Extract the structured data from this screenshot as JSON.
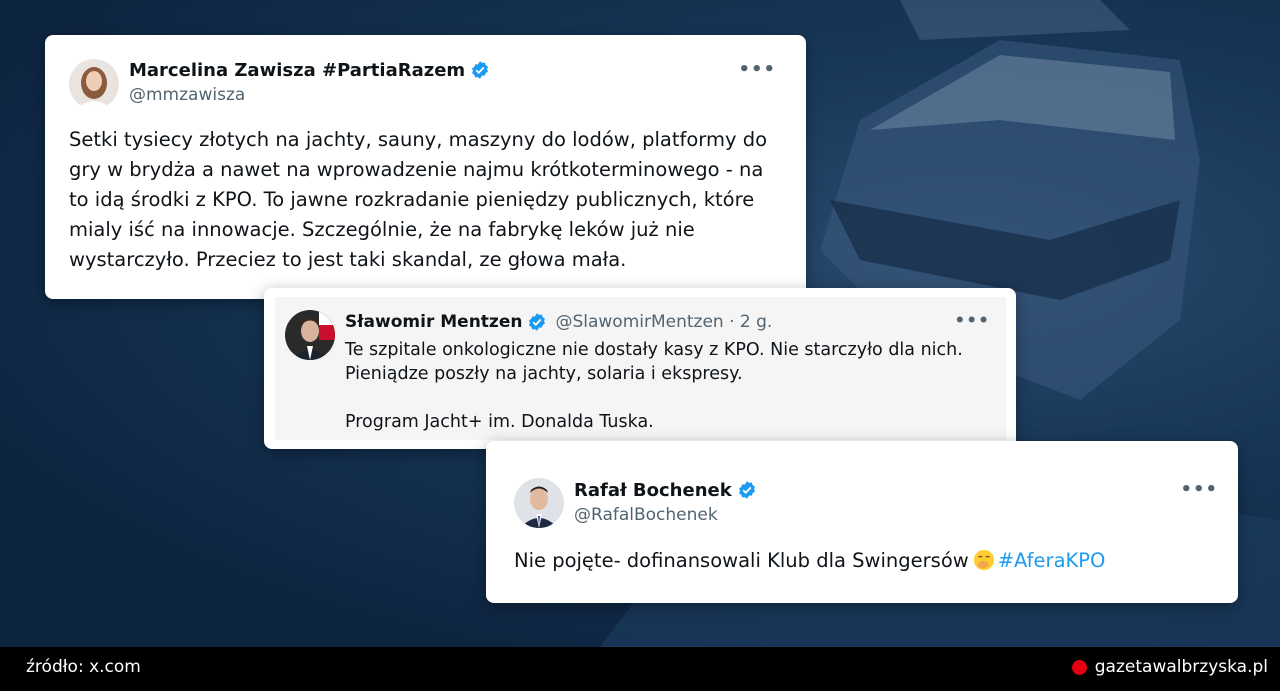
{
  "colors": {
    "verified": "#1d9bf0",
    "hashtag": "#1d9bf0",
    "footer_dot": "#e3000f"
  },
  "tweet1": {
    "name": "Marcelina Zawisza #PartiaRazem",
    "handle": "@mmzawisza",
    "more": "•••",
    "text": "Setki tysiecy złotych na jachty, sauny, maszyny do lodów, platformy do gry w brydża a nawet na wprowadzenie najmu krótkoterminowego - na to idą środki z KPO. To jawne rozkradanie pieniędzy publicznych, które mialy iść na innowacje. Szczególnie, że na fabrykę leków już nie wystarczyło. Przeciez to jest taki skandal, ze głowa mała."
  },
  "tweet2": {
    "name": "Sławomir Mentzen",
    "handle_time": "@SlawomirMentzen · 2 g.",
    "more": "•••",
    "text": "Te szpitale onkologiczne nie dostały kasy z KPO. Nie starczyło dla nich.\nPieniądze poszły na jachty, solaria i ekspresy.\n\nProgram Jacht+ im. Donalda Tuska."
  },
  "tweet3": {
    "name": "Rafał Bochenek",
    "handle": "@RafalBochenek",
    "more": "•••",
    "text": "Nie pojęte- dofinansowali Klub dla Swingersów",
    "emoji": "face-with-hand-over-mouth-emoji",
    "hashtag": "#AferaKPO"
  },
  "footer": {
    "source": "źródło: x.com",
    "site": "gazetawalbrzyska.pl"
  }
}
